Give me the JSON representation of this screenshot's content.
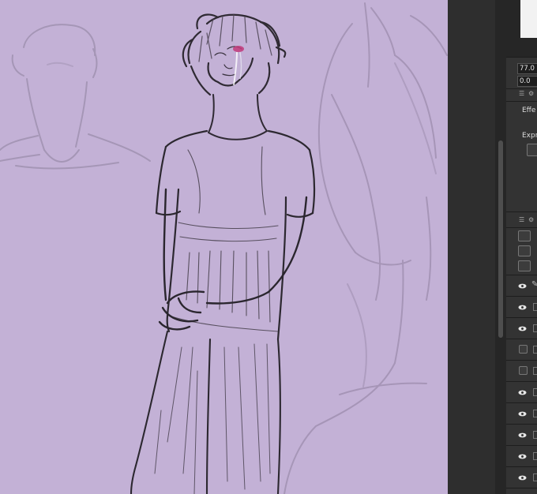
{
  "canvas": {
    "background": "#c3b1d6",
    "artwork": "sketch-figure"
  },
  "panel": {
    "field1_value": "77.0",
    "field2_value": "0.0",
    "effect_label": "Effe",
    "expression_label": "Expr",
    "layer_count": 10
  },
  "colors": {
    "panel_bg": "#333333",
    "panel_dark": "#262626",
    "gutter": "#2e2e2e"
  }
}
